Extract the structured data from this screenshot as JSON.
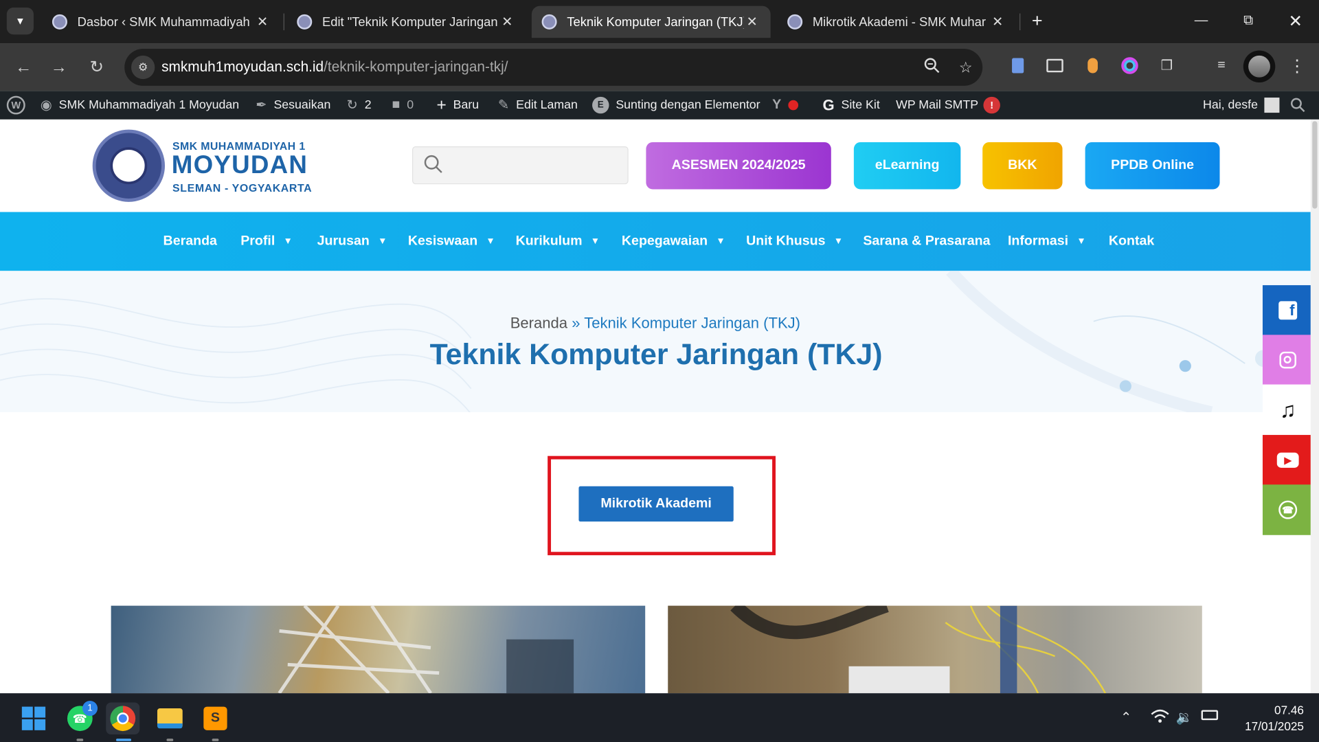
{
  "browser": {
    "tabs": [
      {
        "title": "Dasbor ‹ SMK Muhammadiyah",
        "active": false
      },
      {
        "title": "Edit \"Teknik Komputer Jaringan",
        "active": false
      },
      {
        "title": "Teknik Komputer Jaringan (TKJ)",
        "active": true
      },
      {
        "title": "Mikrotik Akademi - SMK Muhar",
        "active": false
      }
    ],
    "url_host": "smkmuh1moyudan.sch.id",
    "url_path": "/teknik-komputer-jaringan-tkj/"
  },
  "wp_admin_bar": {
    "site_name": "SMK Muhammadiyah 1 Moyudan",
    "customize": "Sesuaikan",
    "updates_count": "2",
    "comments_count": "0",
    "new": "Baru",
    "edit_page": "Edit Laman",
    "elementor": "Sunting dengan Elementor",
    "site_kit": "Site Kit",
    "wp_mail": "WP Mail SMTP",
    "wp_mail_badge": "!",
    "greeting": "Hai, desfe"
  },
  "site_header": {
    "logo_line1": "SMK MUHAMMADIYAH 1",
    "logo_line2": "MOYUDAN",
    "logo_line3": "SLEMAN - YOGYAKARTA",
    "search_placeholder": "",
    "buttons": [
      {
        "label": "ASESMEN 2024/2025",
        "color": "#a23fd6"
      },
      {
        "label": "eLearning",
        "color": "#16c3f0"
      },
      {
        "label": "BKK",
        "color": "#f5b000"
      },
      {
        "label": "PPDB Online",
        "color": "#0f96ef"
      }
    ]
  },
  "main_nav": [
    {
      "label": "Beranda",
      "has_dropdown": false
    },
    {
      "label": "Profil",
      "has_dropdown": true
    },
    {
      "label": "Jurusan",
      "has_dropdown": true
    },
    {
      "label": "Kesiswaan",
      "has_dropdown": true
    },
    {
      "label": "Kurikulum",
      "has_dropdown": true
    },
    {
      "label": "Kepegawaian",
      "has_dropdown": true
    },
    {
      "label": "Unit Khusus",
      "has_dropdown": true
    },
    {
      "label": "Sarana & Prasarana",
      "has_dropdown": false
    },
    {
      "label": "Informasi",
      "has_dropdown": true
    },
    {
      "label": "Kontak",
      "has_dropdown": false
    }
  ],
  "hero": {
    "breadcrumb_home": "Beranda",
    "breadcrumb_sep": "»",
    "breadcrumb_current": "Teknik Komputer Jaringan (TKJ)",
    "title": "Teknik Komputer Jaringan (TKJ)"
  },
  "content": {
    "cta_label": "Mikrotik Akademi"
  },
  "social": [
    {
      "name": "facebook",
      "color": "#1565c0"
    },
    {
      "name": "instagram",
      "color": "#e07ee6"
    },
    {
      "name": "tiktok",
      "color": "#ffffff"
    },
    {
      "name": "youtube",
      "color": "#e31b1b"
    },
    {
      "name": "whatsapp",
      "color": "#7cb342"
    }
  ],
  "taskbar": {
    "whatsapp_badge": "1",
    "time": "07.46",
    "date": "17/01/2025"
  }
}
